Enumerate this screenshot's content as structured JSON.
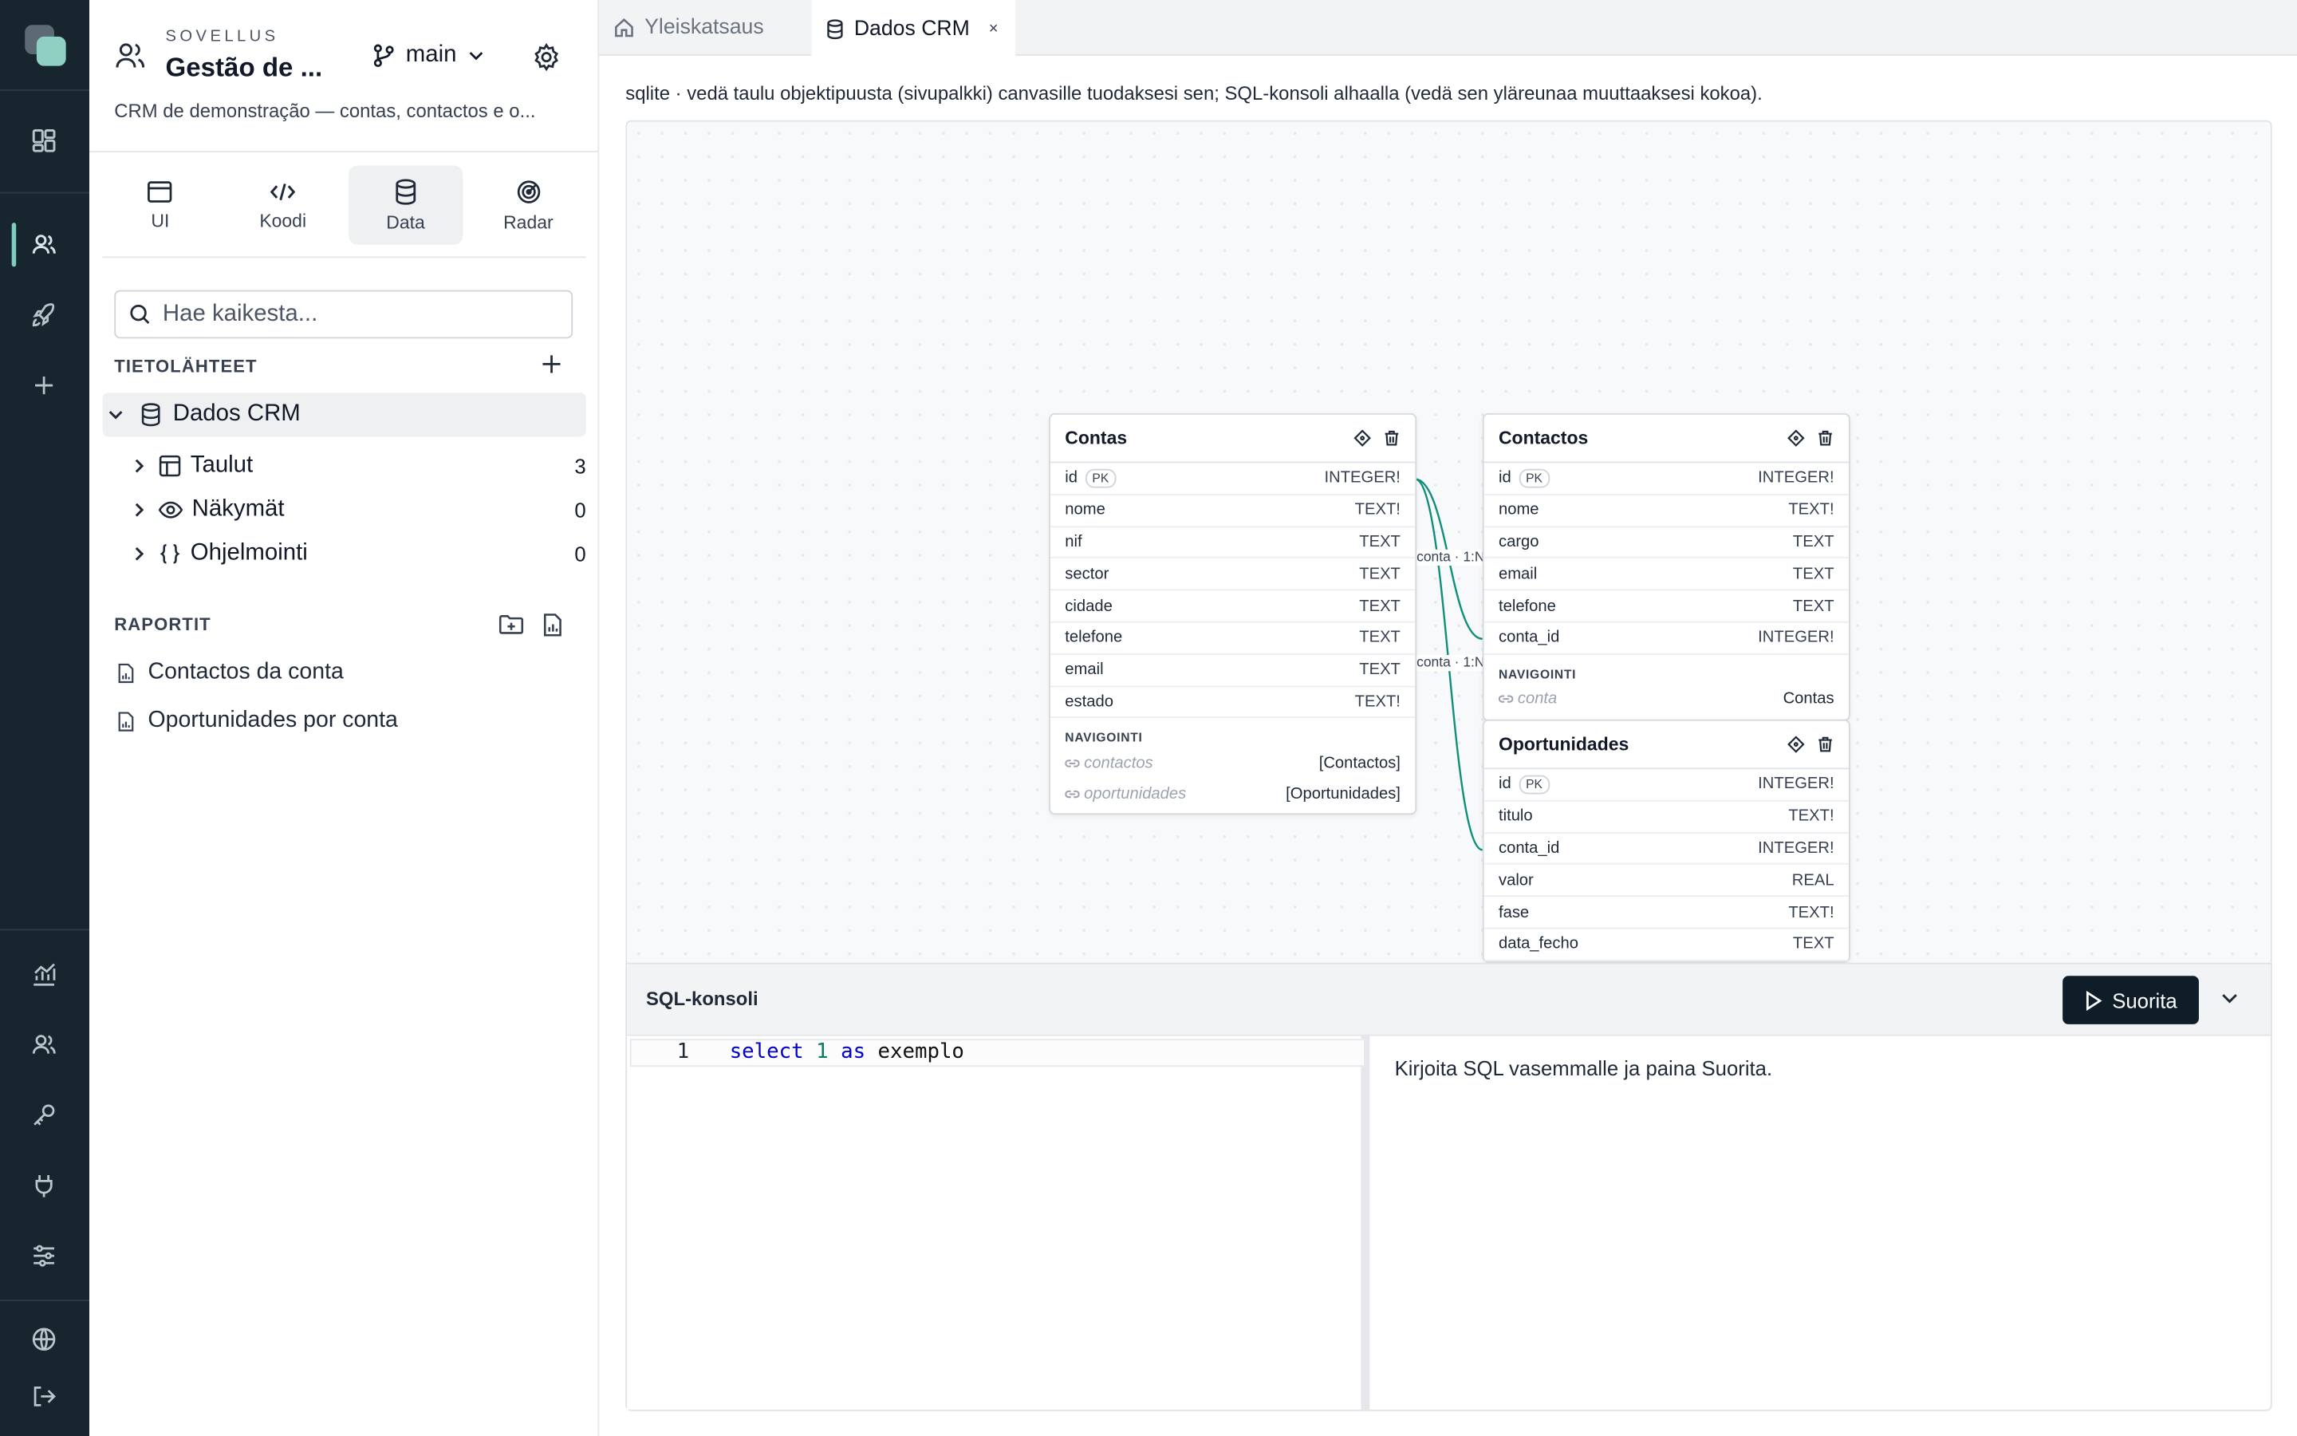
{
  "sidebar": {
    "kicker": "SOVELLUS",
    "app_name": "Gestão de ...",
    "branch": "main",
    "description": "CRM de demonstração — contas, contactos e o...",
    "modes": [
      {
        "label": "UI",
        "icon": "window-icon"
      },
      {
        "label": "Koodi",
        "icon": "code-icon"
      },
      {
        "label": "Data",
        "icon": "database-icon",
        "active": true
      },
      {
        "label": "Radar",
        "icon": "radar-icon"
      }
    ],
    "search_placeholder": "Hae kaikesta...",
    "datasources_title": "TIETOLÄHTEET",
    "datasource": "Dados CRM",
    "tree": [
      {
        "label": "Taulut",
        "count": "3"
      },
      {
        "label": "Näkymät",
        "count": "0"
      },
      {
        "label": "Ohjelmointi",
        "count": "0"
      }
    ],
    "reports_title": "RAPORTIT",
    "reports": [
      "Contactos da conta",
      "Oportunidades por conta"
    ]
  },
  "tabs": [
    {
      "label": "Yleiskatsaus",
      "icon": "home-icon"
    },
    {
      "label": "Dados CRM",
      "icon": "database-icon",
      "active": true,
      "close": "×"
    }
  ],
  "hint": "sqlite · vedä taulu objektipuusta (sivupalkki) canvasille tuodaksesi sen; SQL-konsoli alhaalla (vedä sen yläreunaa muuttaaksesi kokoa).",
  "tables": {
    "contas": {
      "name": "Contas",
      "columns": [
        {
          "name": "id",
          "pk": "PK",
          "type": "INTEGER!"
        },
        {
          "name": "nome",
          "type": "TEXT!"
        },
        {
          "name": "nif",
          "type": "TEXT"
        },
        {
          "name": "sector",
          "type": "TEXT"
        },
        {
          "name": "cidade",
          "type": "TEXT"
        },
        {
          "name": "telefone",
          "type": "TEXT"
        },
        {
          "name": "email",
          "type": "TEXT"
        },
        {
          "name": "estado",
          "type": "TEXT!"
        }
      ],
      "nav_title": "NAVIGOINTI",
      "nav": [
        {
          "name": "contactos",
          "target": "[Contactos]"
        },
        {
          "name": "oportunidades",
          "target": "[Oportunidades]"
        }
      ]
    },
    "contactos": {
      "name": "Contactos",
      "columns": [
        {
          "name": "id",
          "pk": "PK",
          "type": "INTEGER!"
        },
        {
          "name": "nome",
          "type": "TEXT!"
        },
        {
          "name": "cargo",
          "type": "TEXT"
        },
        {
          "name": "email",
          "type": "TEXT"
        },
        {
          "name": "telefone",
          "type": "TEXT"
        },
        {
          "name": "conta_id",
          "type": "INTEGER!"
        }
      ],
      "nav_title": "NAVIGOINTI",
      "nav": [
        {
          "name": "conta",
          "target": "Contas"
        }
      ]
    },
    "oportunidades": {
      "name": "Oportunidades",
      "columns": [
        {
          "name": "id",
          "pk": "PK",
          "type": "INTEGER!"
        },
        {
          "name": "titulo",
          "type": "TEXT!"
        },
        {
          "name": "conta_id",
          "type": "INTEGER!"
        },
        {
          "name": "valor",
          "type": "REAL"
        },
        {
          "name": "fase",
          "type": "TEXT!"
        },
        {
          "name": "data_fecho",
          "type": "TEXT"
        }
      ]
    }
  },
  "relations": [
    {
      "label": "conta · 1:N"
    },
    {
      "label": "conta · 1:N"
    }
  ],
  "console": {
    "title": "SQL-konsoli",
    "run_label": "Suorita",
    "line_number": "1",
    "code": {
      "kw1": "select",
      "num": "1",
      "kw2": "as",
      "ident": "exemplo"
    },
    "result_hint": "Kirjoita SQL vasemmalle ja paina Suorita."
  },
  "colors": {
    "rail": "#17252f",
    "accent": "#7fcdbd",
    "relation": "#0e8f7a",
    "run_button": "#0e1d27"
  }
}
